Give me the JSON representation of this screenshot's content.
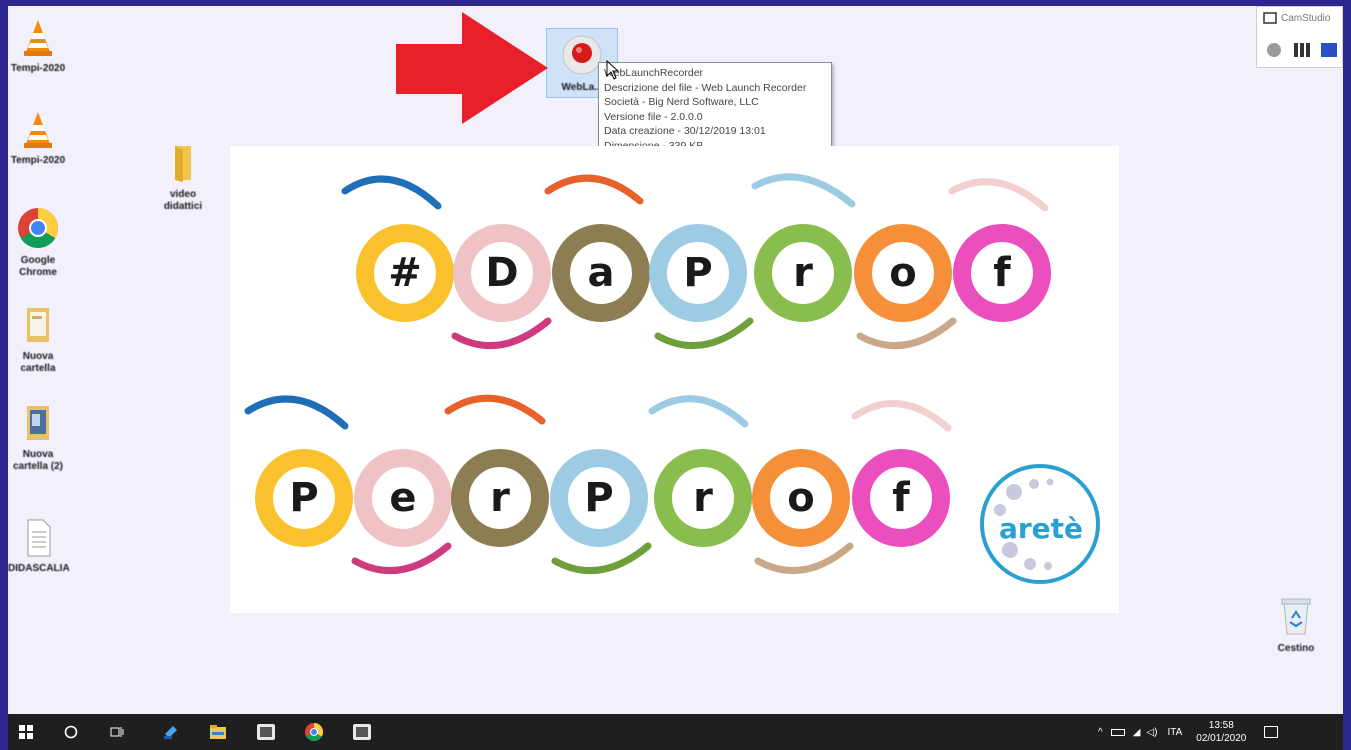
{
  "desktop_icons": [
    {
      "label": "Tempi-2020",
      "icon": "vlc-cone-icon"
    },
    {
      "label": "Tempi-2020",
      "icon": "vlc-cone-icon"
    },
    {
      "label": "Google Chrome",
      "icon": "chrome-icon"
    },
    {
      "label": "Nuova cartella",
      "icon": "folder-icon"
    },
    {
      "label": "Nuova cartella (2)",
      "icon": "folder-icon"
    },
    {
      "label": "DIDASCALIA",
      "icon": "document-icon"
    },
    {
      "label": "video didattici",
      "icon": "folder-icon"
    },
    {
      "label": "WebLa...",
      "icon": "record-icon"
    },
    {
      "label": "Cestino",
      "icon": "recycle-bin-icon"
    }
  ],
  "tooltip": {
    "name": "WebLaunchRecorder",
    "description": "Descrizione del file - Web Launch Recorder",
    "company": "Società - Big Nerd Software, LLC",
    "version": "Versione file - 2.0.0.0",
    "created": "Data creazione - 30/12/2019 13:01",
    "size": "Dimensione - 339 KB"
  },
  "banner": {
    "row1": [
      "#",
      "D",
      "a",
      "P",
      "r",
      "o",
      "f"
    ],
    "row2": [
      "P",
      "e",
      "r",
      "P",
      "r",
      "o",
      "f"
    ],
    "logo_text": "aretè",
    "colors": [
      "#f9c12c",
      "#efc3c6",
      "#8c7d52",
      "#9ccbe3",
      "#89bd4e",
      "#f58f3a",
      "#ea4fbd"
    ]
  },
  "camstudio": {
    "title": "CamStudio"
  },
  "arrow_color": "#e8202a",
  "taskbar": {
    "language": "ITA",
    "time": "13:58",
    "date": "02/01/2020"
  }
}
